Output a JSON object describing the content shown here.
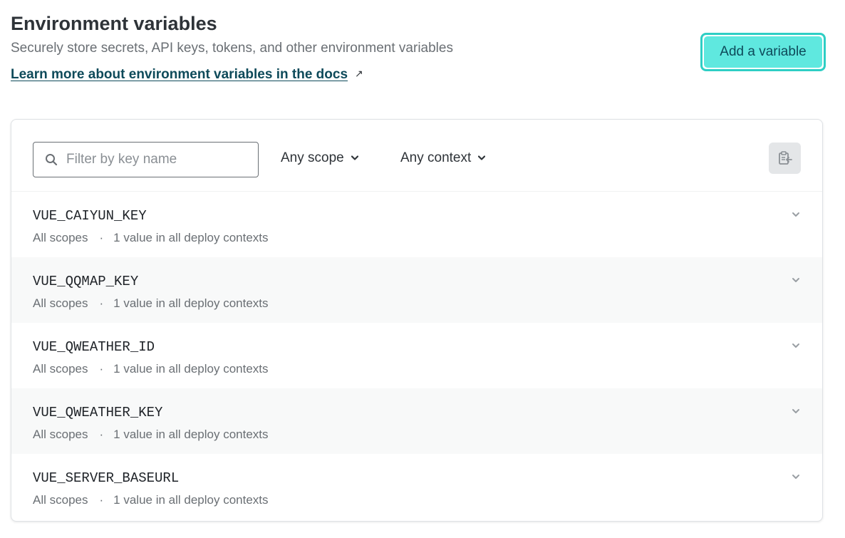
{
  "header": {
    "title": "Environment variables",
    "subtitle": "Securely store secrets, API keys, tokens, and other environment variables",
    "docs_link": "Learn more about environment variables in the docs",
    "docs_link_icon": "external-link-icon",
    "add_button": "Add a variable"
  },
  "toolbar": {
    "search_placeholder": "Filter by key name",
    "search_value": "",
    "scope_dropdown": "Any scope",
    "context_dropdown": "Any context",
    "import_icon": "clipboard-import-icon"
  },
  "variables": [
    {
      "key": "VUE_CAIYUN_KEY",
      "scopes": "All scopes",
      "separator": "·",
      "values": "1 value in all deploy contexts"
    },
    {
      "key": "VUE_QQMAP_KEY",
      "scopes": "All scopes",
      "separator": "·",
      "values": "1 value in all deploy contexts"
    },
    {
      "key": "VUE_QWEATHER_ID",
      "scopes": "All scopes",
      "separator": "·",
      "values": "1 value in all deploy contexts"
    },
    {
      "key": "VUE_QWEATHER_KEY",
      "scopes": "All scopes",
      "separator": "·",
      "values": "1 value in all deploy contexts"
    },
    {
      "key": "VUE_SERVER_BASEURL",
      "scopes": "All scopes",
      "separator": "·",
      "values": "1 value in all deploy contexts"
    }
  ],
  "colors": {
    "accent": "#5fe8df",
    "accent_border": "#2ecec4",
    "link": "#0e4a5a",
    "alt_row": "#f8f9f9"
  }
}
